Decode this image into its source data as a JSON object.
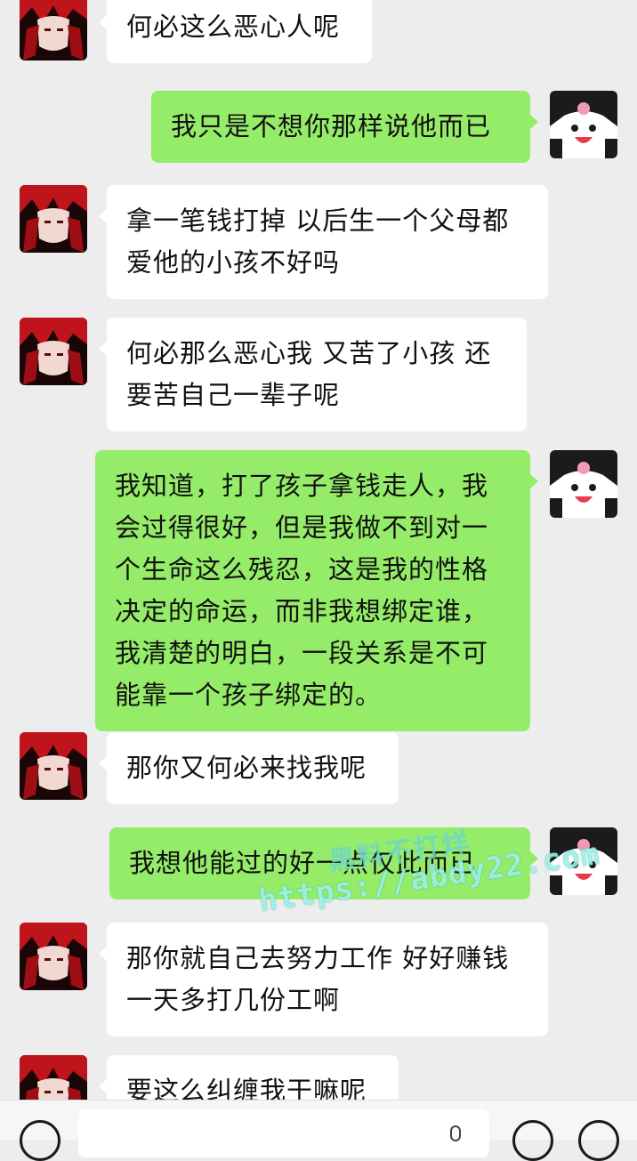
{
  "conversation": {
    "messages": [
      {
        "side": "in",
        "text": "何必这么恶心人呢"
      },
      {
        "side": "out",
        "text": "我只是不想你那样说他而已"
      },
      {
        "side": "in",
        "text": "拿一笔钱打掉 以后生一个父母都爱他的小孩不好吗"
      },
      {
        "side": "in",
        "text": "何必那么恶心我 又苦了小孩 还要苦自己一辈子呢"
      },
      {
        "side": "out",
        "text": "我知道，打了孩子拿钱走人，我会过得很好，但是我做不到对一个生命这么残忍，这是我的性格决定的命运，而非我想绑定谁，我清楚的明白，一段关系是不可能靠一个孩子绑定的。"
      },
      {
        "side": "in",
        "text": "那你又何必来找我呢"
      },
      {
        "side": "out",
        "text": "我想他能过的好一点仅此而已"
      },
      {
        "side": "in",
        "text": "那你就自己去努力工作 好好赚钱一天多打几份工啊"
      },
      {
        "side": "in",
        "text": "要这么纠缠我干嘛呢"
      }
    ]
  },
  "watermark": {
    "line1": "黑料不打烊",
    "line2": "https://abdy22.com"
  },
  "input_bar": {
    "voice_icon": "voice-icon",
    "emoji_icon": "emoji-icon",
    "plus_icon": "plus-icon",
    "input_value": ""
  },
  "colors": {
    "outgoing_bubble": "#95ec69",
    "incoming_bubble": "#ffffff",
    "background": "#ededed"
  }
}
